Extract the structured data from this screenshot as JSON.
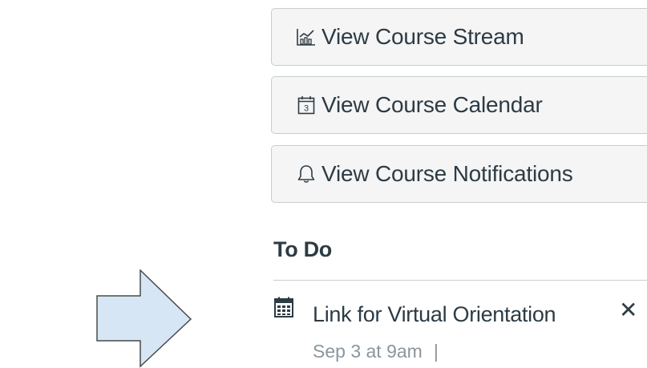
{
  "course_actions": {
    "stream": {
      "label": "View Course Stream",
      "icon": "stream-chart-icon"
    },
    "calendar": {
      "label": "View Course Calendar",
      "icon": "calendar-icon",
      "icon_digit": "3"
    },
    "notifications": {
      "label": "View Course Notifications",
      "icon": "bell-icon"
    }
  },
  "todo": {
    "heading": "To Do",
    "items": [
      {
        "title": "Link for Virtual Orientation",
        "date": "Sep 3 at 9am",
        "separator": "|",
        "dismiss": "✕"
      }
    ]
  },
  "colors": {
    "button_bg": "#f5f5f5",
    "button_border": "#c7cdd1",
    "text": "#2d3b45",
    "muted_text": "#8b969e",
    "arrow_fill": "#d6e6f5",
    "arrow_stroke": "#4a4a4a"
  }
}
